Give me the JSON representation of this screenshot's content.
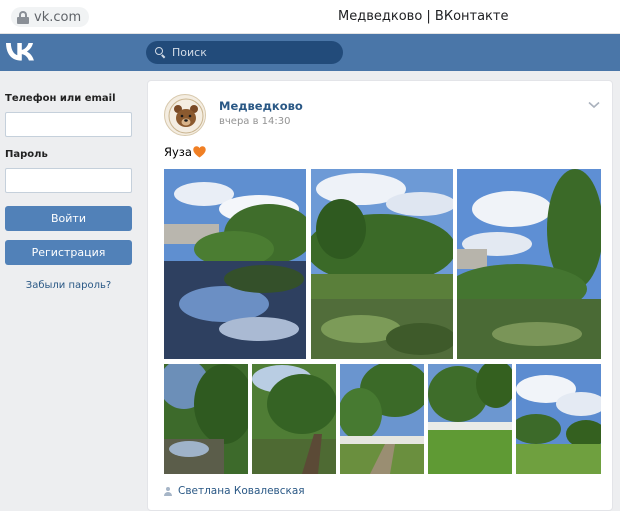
{
  "browser": {
    "url": "vk.com",
    "tab_title": "Медведково | ВКонтакте"
  },
  "header": {
    "logo": "vk-logo",
    "search_placeholder": "Поиск"
  },
  "login": {
    "phone_label": "Телефон или email",
    "phone_value": "",
    "password_label": "Пароль",
    "password_value": "",
    "login_button": "Войти",
    "register_button": "Регистрация",
    "forgot_link": "Забыли пароль?"
  },
  "post": {
    "author": "Медведково",
    "date": "вчера в 14:30",
    "text": "Яуза",
    "emoji_icon": "orange-heart-icon",
    "photos_count_large": 3,
    "photos_count_small": 5,
    "signature": "Светлана Ковалевская"
  },
  "colors": {
    "vk_blue": "#4a76a8",
    "button_blue": "#5181b8",
    "link": "#2a5885",
    "page_bg": "#edeef0"
  }
}
